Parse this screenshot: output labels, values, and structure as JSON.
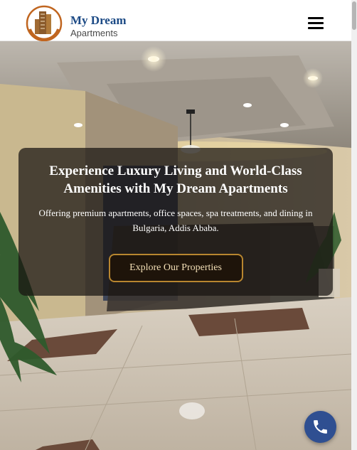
{
  "header": {
    "brand_name": "My Dream",
    "brand_sub": "Apartments",
    "menu_icon": "hamburger-icon"
  },
  "hero": {
    "title": "Experience Luxury Living and World-Class Amenities with My Dream Apartments",
    "text": "Offering premium apartments, office spaces, spa treatments, and dining in Bulgaria, Addis Ababa.",
    "cta_label": "Explore Our Properties"
  },
  "floating": {
    "icon": "phone-icon"
  },
  "colors": {
    "brand_blue": "#1c4a85",
    "logo_orange": "#c0651f",
    "cta_border": "#b8862f",
    "phone_button": "#2f4f91"
  }
}
